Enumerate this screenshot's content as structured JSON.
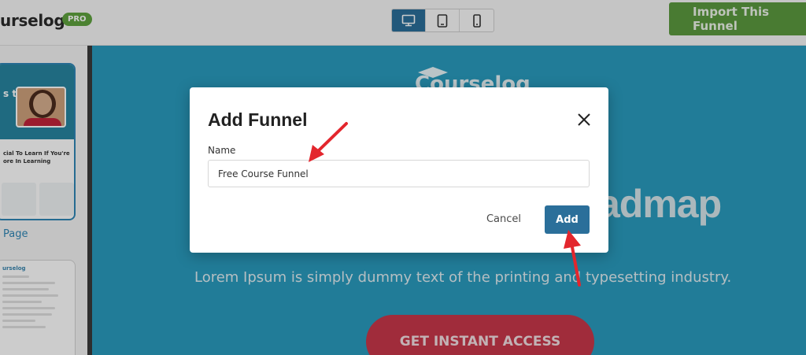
{
  "app": {
    "brand": "urselog",
    "pro_badge": "PRO"
  },
  "toolbar": {
    "devices": [
      {
        "name": "desktop",
        "icon": "desktop-icon",
        "active": true
      },
      {
        "name": "tablet",
        "icon": "tablet-icon",
        "active": false
      },
      {
        "name": "mobile",
        "icon": "mobile-icon",
        "active": false
      }
    ],
    "import_label": "Import This Funnel"
  },
  "sidebar": {
    "thumb1_hero_text": "s to r.",
    "thumb1_body": "cial To Learn If You're ore In Learning",
    "page_label": "Page",
    "thumb2_title": "urselog"
  },
  "preview": {
    "logo": "Courselog",
    "heading": "admap",
    "subtext": "Lorem Ipsum is simply dummy text of the printing and typesetting industry.",
    "cta": "GET INSTANT ACCESS"
  },
  "modal": {
    "title": "Add Funnel",
    "name_label": "Name",
    "name_value": "Free Course Funnel",
    "cancel_label": "Cancel",
    "add_label": "Add"
  },
  "colors": {
    "accent": "#2b6f9a",
    "import_green": "#5c9a3f",
    "preview_bg": "#2a9cbe",
    "cta": "#c8384a",
    "annotation_arrow": "#e3262d"
  }
}
